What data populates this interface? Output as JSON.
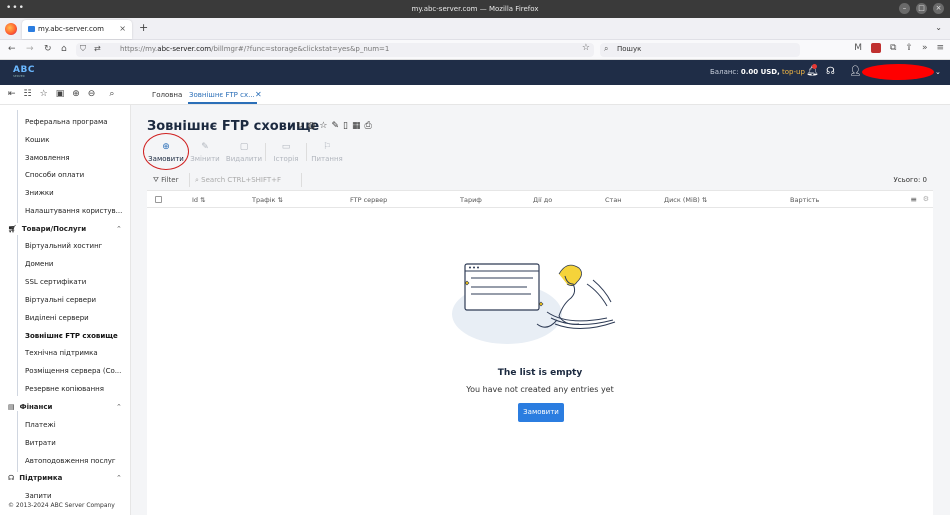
{
  "os": {
    "title": "my.abc-server.com — Mozilla Firefox"
  },
  "browser": {
    "tab_title": "my.abc-server.com",
    "url": "https://my.abc-server.com/billmgr#/?func=storage&clickstat=yes&p_num=1",
    "url_host_prefix": "https://my.",
    "url_host": "abc-server.com",
    "url_rest": "/billmgr#/?func=storage&clickstat=yes&p_num=1",
    "search_placeholder": "Пошук"
  },
  "header": {
    "logo": "ABC",
    "logo_sub": "SERVER",
    "balance_label": "Баланс:",
    "balance_value": "0.00 USD,",
    "topup": "top-up"
  },
  "breadcrumbs": {
    "home": "Головна",
    "current": "Зовнішнє FTP сх..."
  },
  "sidebar": {
    "top_items": [
      "Реферальна програма",
      "Кошик",
      "Замовлення",
      "Способи оплати",
      "Знижки",
      "Налаштування користув..."
    ],
    "products_section": "Товари/Послуги",
    "products_items": [
      "Віртуальний хостинг",
      "Домени",
      "SSL сертифікати",
      "Віртуальні сервери",
      "Виділені сервери",
      "Зовнішнє FTP сховище",
      "Технічна підтримка",
      "Розміщення сервера (Co...",
      "Резервне копіювання"
    ],
    "finance_section": "Фінанси",
    "finance_items": [
      "Платежі",
      "Витрати",
      "Автоподовження послуг"
    ],
    "support_section": "Підтримка",
    "support_items": [
      "Запити"
    ],
    "copyright": "© 2013-2024 ABC Server Company"
  },
  "page": {
    "title": "Зовнішнє FTP сховище",
    "actions": {
      "order": "Замовити",
      "edit": "Змінити",
      "delete": "Видалити",
      "history": "Історія",
      "questions": "Питання"
    },
    "filter_label": "Filter",
    "search_placeholder": "Search CTRL+SHIFT+F",
    "total": "Усього: 0"
  },
  "table": {
    "columns": [
      "Id",
      "Трафік",
      "FTP сервер",
      "Тариф",
      "Дії до",
      "Стан",
      "Диск (MiB)",
      "Вартість"
    ]
  },
  "empty": {
    "title": "The list is empty",
    "subtitle": "You have not created any entries yet",
    "button": "Замовити"
  },
  "colors": {
    "header_bg": "#1f2d47",
    "accent": "#2b7de0",
    "topup": "#f5b942"
  }
}
